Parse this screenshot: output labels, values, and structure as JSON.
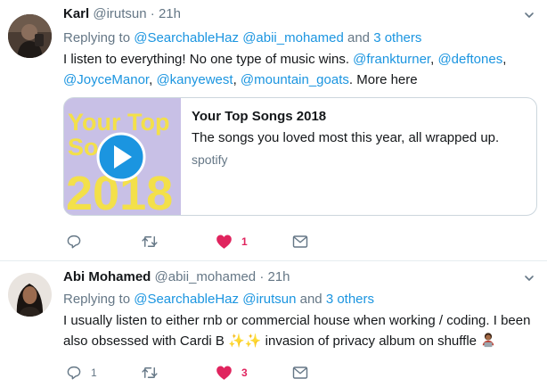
{
  "tweets": [
    {
      "name": "Karl",
      "handle": "@irutsun",
      "dot": "·",
      "time": "21h",
      "reply_prefix": "Replying to",
      "reply_to_1": "@SearchableHaz",
      "reply_to_2": "@abii_mohamed",
      "reply_and": "and",
      "reply_others": "3 others",
      "body_line1_text": "I listen to everything! No one type of music wins.",
      "body_line1_link1": "@frankturner",
      "body_line1_sep": ",",
      "body_line1_link2": "@deftones",
      "body_line1_end": ",",
      "body_line2_link1": "@JoyceManor",
      "body_line2_sep1": ",",
      "body_line2_link2": "@kanyewest",
      "body_line2_sep2": ",",
      "body_line2_link3": "@mountain_goats",
      "body_line2_sep3": ".",
      "body_line2_more": "More here",
      "card": {
        "image_text_1": "Your Top",
        "image_text_2": "Songs",
        "image_text_3": "2018",
        "title": "Your Top Songs 2018",
        "description": "The songs you loved most this year, all wrapped up.",
        "domain": "spotify"
      },
      "actions": {
        "reply_count": "",
        "retweet_count": "",
        "like_count": "1"
      }
    },
    {
      "name": "Abi Mohamed",
      "handle": "@abii_mohamed",
      "dot": "·",
      "time": "21h",
      "reply_prefix": "Replying to",
      "reply_to_1": "@SearchableHaz",
      "reply_to_2": "@irutsun",
      "reply_and": "and",
      "reply_others": "3 others",
      "body_line1": "I usually listen to either rnb or commercial house when working / coding. I been",
      "body_line2_a": "also obsessed with Cardi B",
      "body_line2_emoji": "✨✨",
      "body_line2_b": "invasion of privacy album on shuffle",
      "actions": {
        "reply_count": "1",
        "retweet_count": "",
        "like_count": "3"
      }
    }
  ],
  "colors": {
    "link": "#1b95e0",
    "muted": "#657786",
    "like": "#e0245e",
    "border": "#e6ecf0"
  }
}
